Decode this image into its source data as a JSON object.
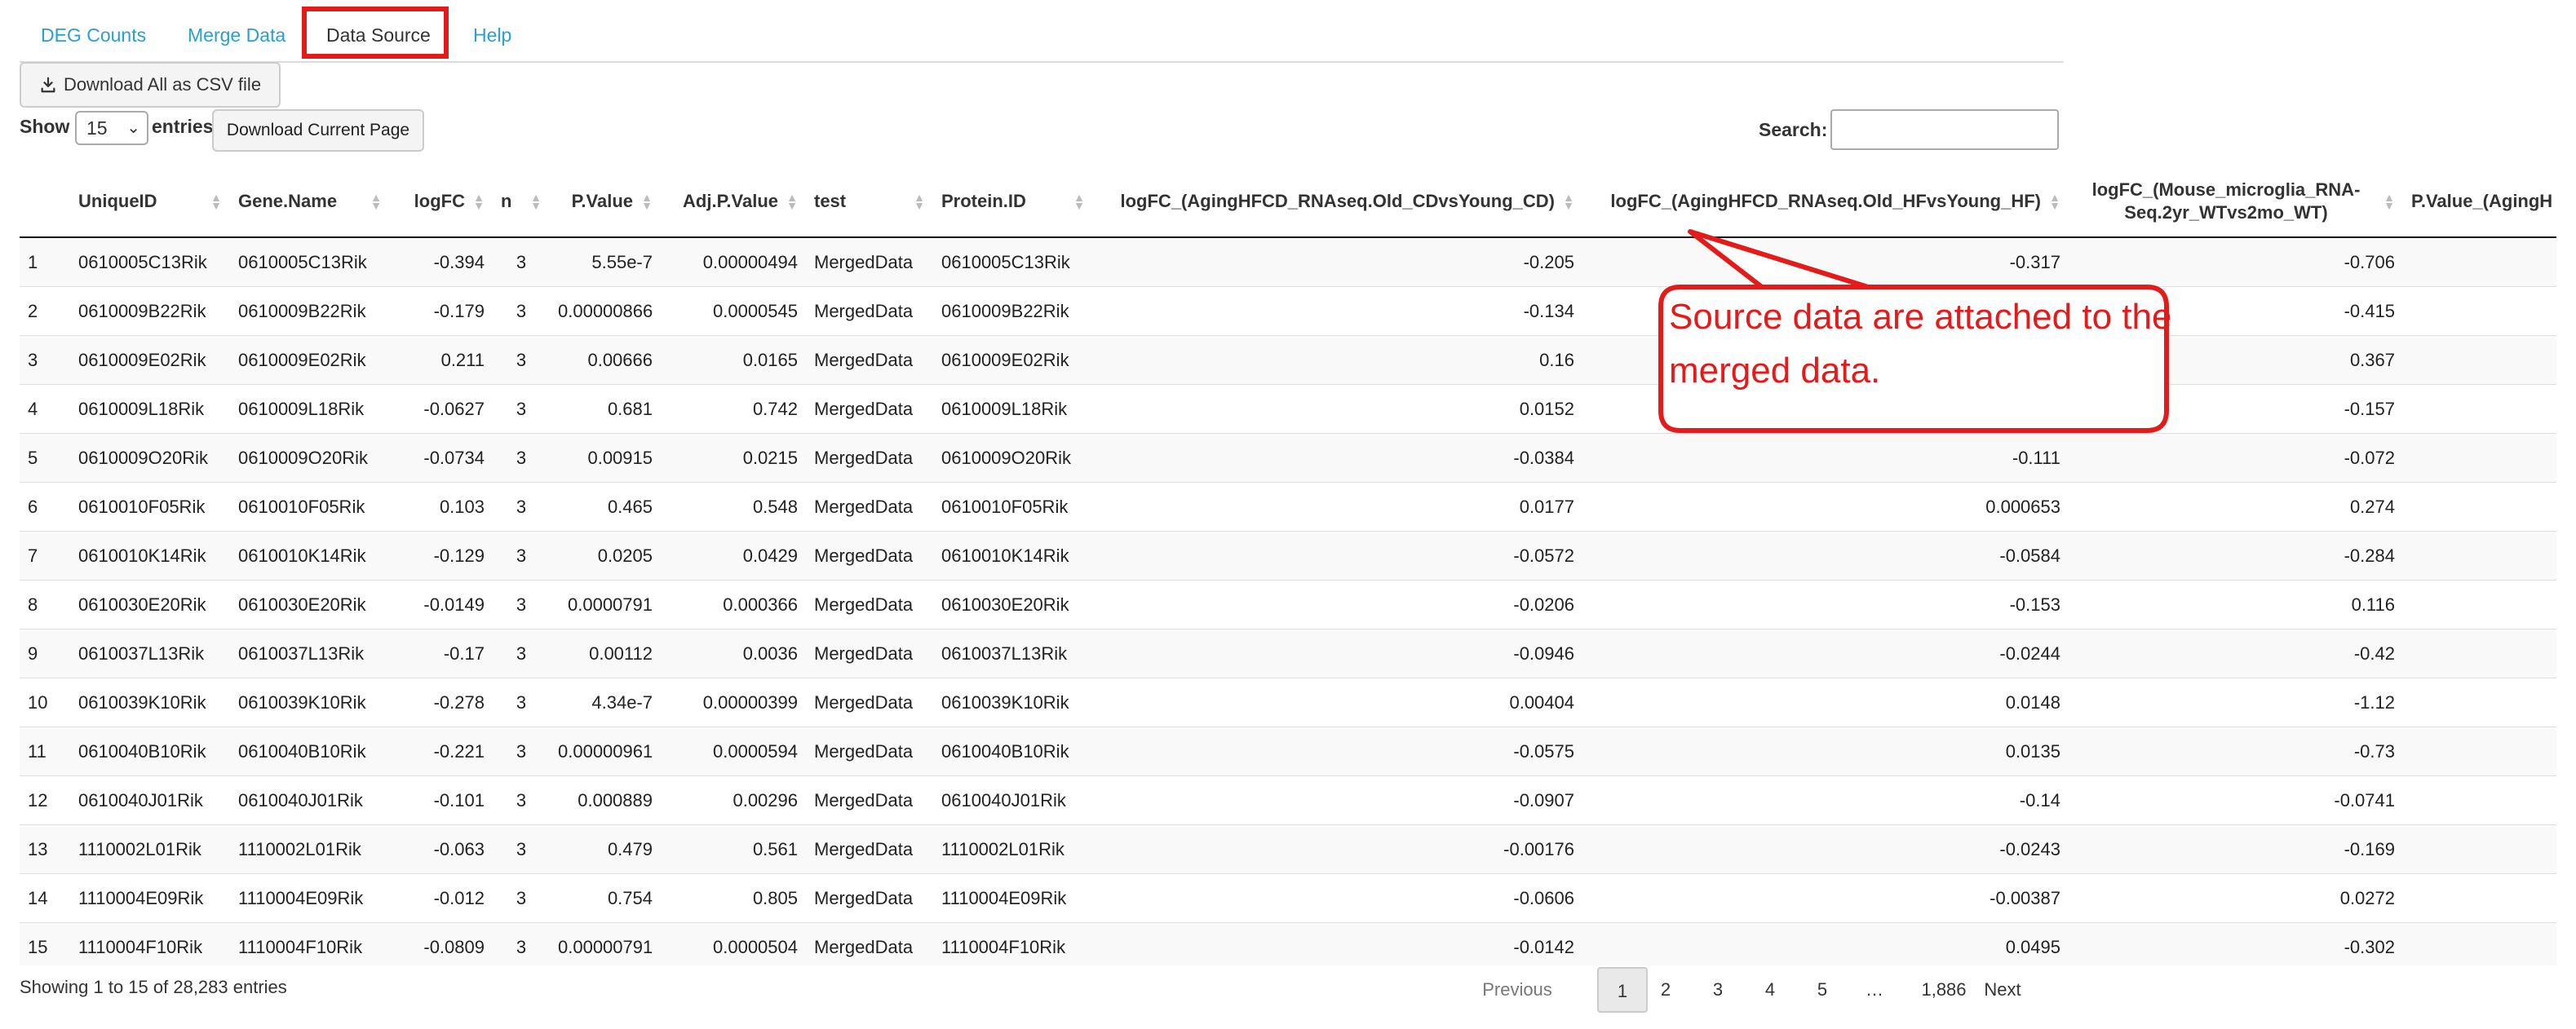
{
  "tabs": [
    "DEG Counts",
    "Merge Data",
    "Data Source",
    "Help"
  ],
  "buttons": {
    "download_csv": "Download All as CSV file",
    "download_page": "Download Current Page"
  },
  "length": {
    "show": "Show",
    "value": "15",
    "entries": "entries"
  },
  "search": {
    "label": "Search:",
    "value": ""
  },
  "columns": [
    "",
    "UniqueID",
    "Gene.Name",
    "logFC",
    "n",
    "P.Value",
    "Adj.P.Value",
    "test",
    "Protein.ID",
    "logFC_(AgingHFCD_RNAseq.Old_CDvsYoung_CD)",
    "logFC_(AgingHFCD_RNAseq.Old_HFvsYoung_HF)",
    "logFC_(Mouse_microglia_RNA-Seq.2yr_WTvs2mo_WT)",
    "P.Value_(AgingH"
  ],
  "rows": [
    [
      "1",
      "0610005C13Rik",
      "0610005C13Rik",
      "-0.394",
      "3",
      "5.55e-7",
      "0.00000494",
      "MergedData",
      "0610005C13Rik",
      "-0.205",
      "-0.317",
      "-0.706",
      ""
    ],
    [
      "2",
      "0610009B22Rik",
      "0610009B22Rik",
      "-0.179",
      "3",
      "0.00000866",
      "0.0000545",
      "MergedData",
      "0610009B22Rik",
      "-0.134",
      "",
      "-0.415",
      ""
    ],
    [
      "3",
      "0610009E02Rik",
      "0610009E02Rik",
      "0.211",
      "3",
      "0.00666",
      "0.0165",
      "MergedData",
      "0610009E02Rik",
      "0.16",
      "",
      "0.367",
      ""
    ],
    [
      "4",
      "0610009L18Rik",
      "0610009L18Rik",
      "-0.0627",
      "3",
      "0.681",
      "0.742",
      "MergedData",
      "0610009L18Rik",
      "0.0152",
      "",
      "-0.157",
      ""
    ],
    [
      "5",
      "0610009O20Rik",
      "0610009O20Rik",
      "-0.0734",
      "3",
      "0.00915",
      "0.0215",
      "MergedData",
      "0610009O20Rik",
      "-0.0384",
      "-0.111",
      "-0.072",
      ""
    ],
    [
      "6",
      "0610010F05Rik",
      "0610010F05Rik",
      "0.103",
      "3",
      "0.465",
      "0.548",
      "MergedData",
      "0610010F05Rik",
      "0.0177",
      "0.000653",
      "0.274",
      ""
    ],
    [
      "7",
      "0610010K14Rik",
      "0610010K14Rik",
      "-0.129",
      "3",
      "0.0205",
      "0.0429",
      "MergedData",
      "0610010K14Rik",
      "-0.0572",
      "-0.0584",
      "-0.284",
      ""
    ],
    [
      "8",
      "0610030E20Rik",
      "0610030E20Rik",
      "-0.0149",
      "3",
      "0.0000791",
      "0.000366",
      "MergedData",
      "0610030E20Rik",
      "-0.0206",
      "-0.153",
      "0.116",
      ""
    ],
    [
      "9",
      "0610037L13Rik",
      "0610037L13Rik",
      "-0.17",
      "3",
      "0.00112",
      "0.0036",
      "MergedData",
      "0610037L13Rik",
      "-0.0946",
      "-0.0244",
      "-0.42",
      ""
    ],
    [
      "10",
      "0610039K10Rik",
      "0610039K10Rik",
      "-0.278",
      "3",
      "4.34e-7",
      "0.00000399",
      "MergedData",
      "0610039K10Rik",
      "0.00404",
      "0.0148",
      "-1.12",
      ""
    ],
    [
      "11",
      "0610040B10Rik",
      "0610040B10Rik",
      "-0.221",
      "3",
      "0.00000961",
      "0.0000594",
      "MergedData",
      "0610040B10Rik",
      "-0.0575",
      "0.0135",
      "-0.73",
      ""
    ],
    [
      "12",
      "0610040J01Rik",
      "0610040J01Rik",
      "-0.101",
      "3",
      "0.000889",
      "0.00296",
      "MergedData",
      "0610040J01Rik",
      "-0.0907",
      "-0.14",
      "-0.0741",
      ""
    ],
    [
      "13",
      "1110002L01Rik",
      "1110002L01Rik",
      "-0.063",
      "3",
      "0.479",
      "0.561",
      "MergedData",
      "1110002L01Rik",
      "-0.00176",
      "-0.0243",
      "-0.169",
      ""
    ],
    [
      "14",
      "1110004E09Rik",
      "1110004E09Rik",
      "-0.012",
      "3",
      "0.754",
      "0.805",
      "MergedData",
      "1110004E09Rik",
      "-0.0606",
      "-0.00387",
      "0.0272",
      ""
    ],
    [
      "15",
      "1110004F10Rik",
      "1110004F10Rik",
      "-0.0809",
      "3",
      "0.00000791",
      "0.0000504",
      "MergedData",
      "1110004F10Rik",
      "-0.0142",
      "0.0495",
      "-0.302",
      ""
    ]
  ],
  "info": "Showing 1 to 15 of 28,283 entries",
  "pagination": [
    "Previous",
    "1",
    "2",
    "3",
    "4",
    "5",
    "…",
    "1,886",
    "Next"
  ],
  "annotation": {
    "text": "Source data are attached to the merged data.",
    "color": "#e31b1b"
  },
  "colors": {
    "link": "#2a9fd6",
    "annotation": "#e31b1b"
  }
}
